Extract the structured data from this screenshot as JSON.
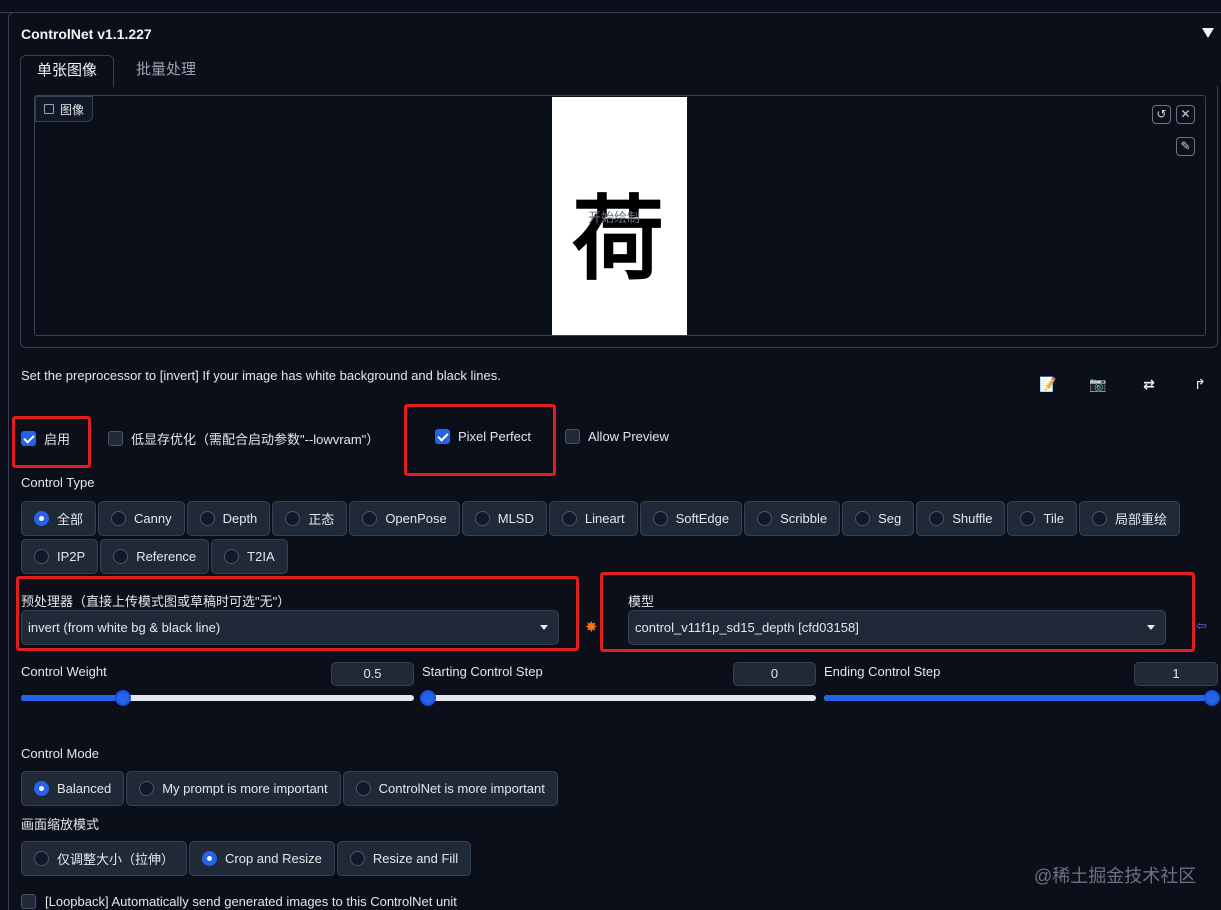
{
  "panel": {
    "title": "ControlNet v1.1.227",
    "collapse_icon": "triangle-down-icon"
  },
  "tabs": [
    {
      "label": "单张图像",
      "active": true
    },
    {
      "label": "批量处理",
      "active": false
    }
  ],
  "image_input": {
    "label": "图像",
    "label_icon": "image-icon",
    "canvas_char": "荷",
    "canvas_hint": "开始绘制",
    "buttons": [
      "undo-icon",
      "close-icon",
      "brush-icon"
    ]
  },
  "hint": "Set the preprocessor to [invert] If your image has white background and black lines.",
  "toolbar_icons": [
    "edit-icon",
    "camera-icon",
    "swap-icon",
    "send-icon"
  ],
  "checkboxes": {
    "enable": {
      "label": "启用",
      "checked": true
    },
    "lowvram": {
      "label": "低显存优化（需配合启动参数\"--lowvram\"）",
      "checked": false
    },
    "pixel_perfect": {
      "label": "Pixel Perfect",
      "checked": true
    },
    "allow_preview": {
      "label": "Allow Preview",
      "checked": false
    }
  },
  "control_type": {
    "label": "Control Type",
    "row1": [
      "全部",
      "Canny",
      "Depth",
      "正态",
      "OpenPose",
      "MLSD",
      "Lineart",
      "SoftEdge",
      "Scribble",
      "Seg",
      "Shuffle",
      "Tile",
      "局部重绘"
    ],
    "row2": [
      "IP2P",
      "Reference",
      "T2IA"
    ],
    "selected": "全部"
  },
  "preprocessor": {
    "label": "预处理器（直接上传模式图或草稿时可选\"无\"）",
    "value": "invert (from white bg & black line)"
  },
  "model": {
    "label": "模型",
    "value": "control_v11f1p_sd15_depth [cfd03158]"
  },
  "sliders": {
    "weight": {
      "label": "Control Weight",
      "value": "0.5",
      "fraction": 0.26
    },
    "start": {
      "label": "Starting Control Step",
      "value": "0",
      "fraction": 0.0
    },
    "end": {
      "label": "Ending Control Step",
      "value": "1",
      "fraction": 1.0
    }
  },
  "control_mode": {
    "label": "Control Mode",
    "options": [
      "Balanced",
      "My prompt is more important",
      "ControlNet is more important"
    ],
    "selected": "Balanced"
  },
  "resize_mode": {
    "label": "画面缩放模式",
    "options": [
      "仅调整大小（拉伸）",
      "Crop and Resize",
      "Resize and Fill"
    ],
    "selected": "Crop and Resize"
  },
  "loopback": {
    "label": "[Loopback] Automatically send generated images to this ControlNet unit",
    "checked": false
  },
  "watermark": "@稀土掘金技术社区",
  "colors": {
    "accent": "#2563eb",
    "highlight": "#e11d1d",
    "bg": "#0b0f19"
  }
}
